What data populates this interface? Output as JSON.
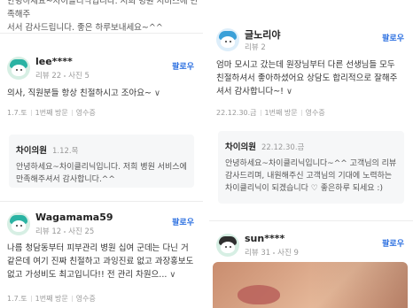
{
  "left": {
    "top_card": {
      "line1": "안녕하세요~차이클리닉입니다. 저희 병원 서비스에 만족해주",
      "line2": "서서 감사드립니다. 좋은 하루보내세요~^^"
    },
    "review1": {
      "nickname": "lee****",
      "review_count": "리뷰 22",
      "photo_count": "사진 5",
      "follow_label": "팔로우",
      "text": "의사, 직원분들 항상 친절하시고 조아요~",
      "more": "∨",
      "date": "1.7.토",
      "visit": "1번째 방문",
      "receipt": "영수증",
      "reply": {
        "name": "차이의원",
        "date": "1.12.목",
        "text": "안녕하세요~차이클리닉입니다. 저희 병원 서비스에 만족해주셔서 감사합니다.^^"
      }
    },
    "review2": {
      "nickname": "Wagamama59",
      "review_count": "리뷰 12",
      "photo_count": "사진 25",
      "follow_label": "팔로우",
      "text": "나름 청담동부터 피부관리 병원 십여 군데는 다닌 거 같은데 여기 진짜 친절하고 과잉진료 없고 과장홍보도 없고 가성비도 최고입니다!! 전 관리 차원으...",
      "more": "∨",
      "date": "1.7.토",
      "visit": "1번째 방문",
      "receipt": "영수증"
    }
  },
  "right": {
    "review1": {
      "nickname": "글노리야",
      "review_count": "리뷰 2",
      "follow_label": "팔로우",
      "text": "엄마 모시고 갔는데 원장님부터 다른 선생님들 모두 친절하셔서 좋아하셨어요 상담도 합리적으로 잘해주셔서 감사합니다~!",
      "more": "∨",
      "date": "22.12.30.금",
      "visit": "1번째 방문",
      "receipt": "영수증",
      "reply": {
        "name": "차이의원",
        "date": "22.12.30.금",
        "text": "안녕하세요~차이클리닉입니다~^^ 고객님의 리뷰 감사드리며, 내원해주신 고객님의 기대에 노력하는 차이클리닉이 되겠습니다 ♡ 좋은하루 되세요 :)"
      }
    },
    "review2": {
      "nickname": "sun****",
      "review_count": "리뷰 31",
      "photo_count": "사진 9",
      "follow_label": "팔로우"
    }
  }
}
